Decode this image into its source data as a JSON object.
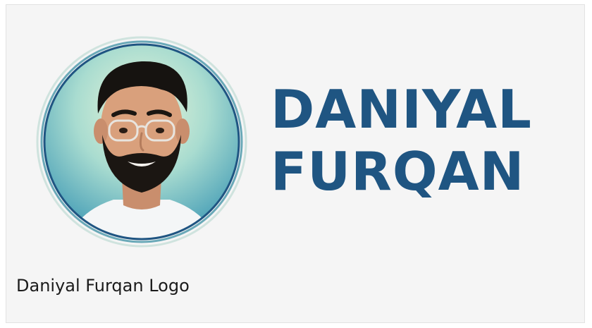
{
  "logo": {
    "name_line1": "DANIYAL",
    "name_line2": "FURQAN",
    "avatar_icon": "person-portrait-icon"
  },
  "caption": "Daniyal Furqan Logo",
  "colors": {
    "brand_text": "#1f5582",
    "card_background": "#f5f5f5",
    "avatar_ring": "#1f5582"
  }
}
